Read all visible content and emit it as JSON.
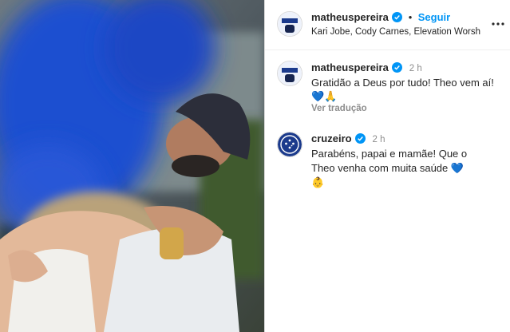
{
  "post": {
    "author": "matheuspereira",
    "follow_label": "Seguir",
    "separator": "•",
    "audio": "Kari Jobe, Cody Carnes, Elevation Worshi...",
    "more_icon": "more-icon"
  },
  "caption": {
    "author": "matheuspereira",
    "time": "2 h",
    "text": "Gratidão a Deus por tudo! Theo vem aí!",
    "emojis": "💙🙏",
    "translate_label": "Ver tradução"
  },
  "comments": [
    {
      "author": "cruzeiro",
      "time": "2 h",
      "text_line1": "Parabéns, papai e mamãe! Que o",
      "text_line2": "Theo venha com muita saúde",
      "heart": "💙",
      "emoji": "👶"
    }
  ],
  "colors": {
    "accent": "#0095f6",
    "smoke": "#1f4fd0",
    "cruzeiro_blue": "#1b3a8c"
  }
}
